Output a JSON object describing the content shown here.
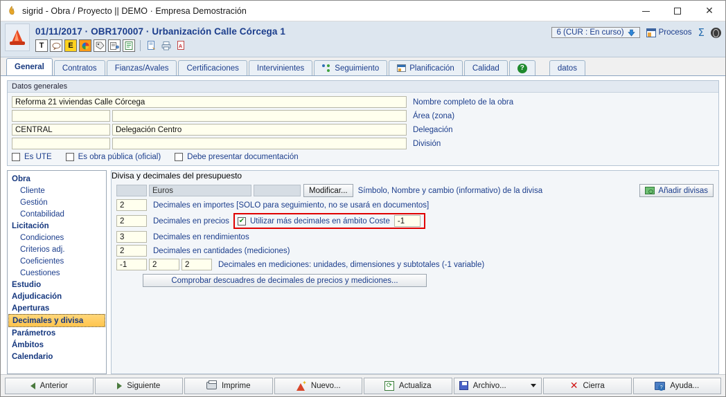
{
  "window": {
    "title": "sigrid - Obra / Proyecto || DEMO · Empresa Demostración",
    "app_icon": "flame-icon",
    "controls": {
      "minimize": "minimize-icon",
      "maximize": "maximize-icon",
      "close": "close-icon"
    }
  },
  "header": {
    "record_title": "01/11/2017 · OBR170007 · Urbanización Calle Córcega 1",
    "status_pill": "6 (CUR : En curso)",
    "procesos_label": "Procesos",
    "sigma_label": "Σ",
    "toolbar_icons": [
      "text-icon",
      "comment-icon",
      "excel-icon",
      "color-icon",
      "tag-icon",
      "report-icon",
      "document-green-icon",
      "preview-icon",
      "print-icon",
      "pdf-icon"
    ]
  },
  "tabs": [
    {
      "label": "General",
      "active": true,
      "icon": null
    },
    {
      "label": "Contratos",
      "active": false,
      "icon": null
    },
    {
      "label": "Fianzas/Avales",
      "active": false,
      "icon": null
    },
    {
      "label": "Certificaciones",
      "active": false,
      "icon": null
    },
    {
      "label": "Intervinientes",
      "active": false,
      "icon": null
    },
    {
      "label": "Seguimiento",
      "active": false,
      "icon": "seguimiento-icon"
    },
    {
      "label": "Planificación",
      "active": false,
      "icon": "planificacion-icon"
    },
    {
      "label": "Calidad",
      "active": false,
      "icon": null
    },
    {
      "label": "",
      "active": false,
      "icon": "help-icon"
    },
    {
      "label": "datos",
      "active": false,
      "icon": null,
      "detached": true
    }
  ],
  "datos_generales": {
    "group_title": "Datos generales",
    "rows": [
      {
        "value": "Reforma 21 viviendas Calle Córcega",
        "second": null,
        "label": "Nombre completo de la obra",
        "wide": true
      },
      {
        "value": "",
        "second": "",
        "label": "Área (zona)",
        "wide": false
      },
      {
        "value": "CENTRAL",
        "second": "Delegación Centro",
        "label": "Delegación",
        "wide": false
      },
      {
        "value": "",
        "second": "",
        "label": "División",
        "wide": false
      }
    ],
    "checkboxes": [
      {
        "label": "Es UTE",
        "checked": false
      },
      {
        "label": "Es obra pública (oficial)",
        "checked": false
      },
      {
        "label": "Debe presentar documentación",
        "checked": false
      }
    ]
  },
  "tree": {
    "items": [
      {
        "label": "Obra",
        "level": "root",
        "selected": false
      },
      {
        "label": "Cliente",
        "level": "child",
        "selected": false
      },
      {
        "label": "Gestión",
        "level": "child",
        "selected": false
      },
      {
        "label": "Contabilidad",
        "level": "child",
        "selected": false
      },
      {
        "label": "Licitación",
        "level": "root",
        "selected": false
      },
      {
        "label": "Condiciones",
        "level": "child",
        "selected": false
      },
      {
        "label": "Criterios adj.",
        "level": "child",
        "selected": false
      },
      {
        "label": "Coeficientes",
        "level": "child",
        "selected": false
      },
      {
        "label": "Cuestiones",
        "level": "child",
        "selected": false
      },
      {
        "label": "Estudio",
        "level": "root",
        "selected": false
      },
      {
        "label": "Adjudicación",
        "level": "root",
        "selected": false
      },
      {
        "label": "Aperturas",
        "level": "root",
        "selected": false
      },
      {
        "label": "Decimales y divisa",
        "level": "root",
        "selected": true
      },
      {
        "label": "Parámetros",
        "level": "root",
        "selected": false
      },
      {
        "label": "Ámbitos",
        "level": "root",
        "selected": false
      },
      {
        "label": "Calendario",
        "level": "root",
        "selected": false
      }
    ]
  },
  "panel": {
    "group_title": "Divisa y decimales del presupuesto",
    "currency_row": {
      "symbol": "",
      "name": "Euros",
      "rate": "",
      "modify_button": "Modificar...",
      "hint": "Símbolo, Nombre y cambio (informativo) de la divisa",
      "add_button": "Añadir divisas",
      "add_button_icon": "money-icon"
    },
    "decimal_rows": [
      {
        "value": "2",
        "label": "Decimales en importes [SOLO para seguimiento, no se usará en documentos]"
      },
      {
        "value": "2",
        "label": "Decimales en precios"
      },
      {
        "value": "3",
        "label": "Decimales en rendimientos"
      },
      {
        "value": "2",
        "label": "Decimales en cantidades (mediciones)"
      }
    ],
    "highlight": {
      "checkbox_label": "Utilizar más decimales en ámbito Coste",
      "checkbox_checked": true,
      "extra_value": "-1",
      "border_color": "#e00000"
    },
    "measure_row": {
      "values": [
        "-1",
        "2",
        "2"
      ],
      "label": "Decimales en mediciones: unidades, dimensiones y subtotales (-1 variable)"
    },
    "check_button": "Comprobar descuadres de decimales de precios y mediciones..."
  },
  "bottom_bar": {
    "buttons": [
      {
        "label": "Anterior",
        "icon": "arrow-left-icon"
      },
      {
        "label": "Siguiente",
        "icon": "arrow-right-icon"
      },
      {
        "label": "Imprime",
        "icon": "printer-icon"
      },
      {
        "label": "Nuevo...",
        "icon": "new-icon"
      },
      {
        "label": "Actualiza",
        "icon": "refresh-icon"
      },
      {
        "label": "Archivo...",
        "icon": "floppy-icon",
        "has_dropdown": true
      },
      {
        "label": "Cierra",
        "icon": "close-x-icon"
      },
      {
        "label": "Ayuda...",
        "icon": "help-book-icon"
      }
    ]
  }
}
